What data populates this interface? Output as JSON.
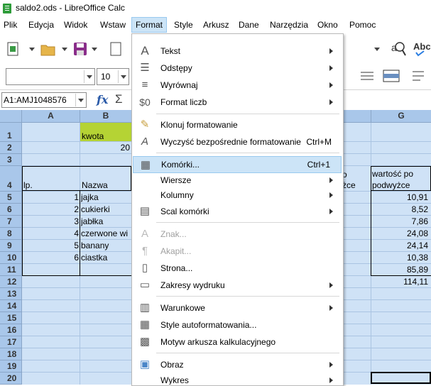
{
  "window": {
    "title": "saldo2.ods - LibreOffice Calc"
  },
  "menubar": [
    {
      "label": "Plik"
    },
    {
      "label": "Edycja"
    },
    {
      "label": "Widok"
    },
    {
      "label": "Wstaw"
    },
    {
      "label": "Format",
      "active": true
    },
    {
      "label": "Style"
    },
    {
      "label": "Arkusz"
    },
    {
      "label": "Dane"
    },
    {
      "label": "Narzędzia"
    },
    {
      "label": "Okno"
    },
    {
      "label": "Pomoc"
    }
  ],
  "toolbar2": {
    "font_size": "10"
  },
  "formulabar": {
    "name_box": "A1:AMJ1048576",
    "fx": "fx",
    "sigma": "Σ"
  },
  "columns": [
    "A",
    "B",
    "G"
  ],
  "rows": [
    "1",
    "2",
    "3",
    "4",
    "5",
    "6",
    "7",
    "8",
    "9",
    "10",
    "11",
    "12",
    "13",
    "14",
    "15",
    "16",
    "17",
    "18",
    "19",
    "20"
  ],
  "cells": {
    "b1": "kwota",
    "b2": "20",
    "a4": "lp.",
    "b4": "Nazwa",
    "g4_line1": "wartość po",
    "g4_line2": "podwyżce",
    "f4_line1": "o",
    "f4_line2": "żce",
    "lp": [
      "1",
      "2",
      "3",
      "4",
      "5",
      "6"
    ],
    "names": [
      "jajka",
      "cukierki",
      "jabłka",
      "czerwone wi",
      "banany",
      "ciastka"
    ],
    "g_values": [
      "10,91",
      "8,52",
      "7,86",
      "24,08",
      "24,14",
      "10,38",
      "85,89",
      "114,11"
    ]
  },
  "format_menu": {
    "items": [
      {
        "label": "Tekst",
        "submenu": true,
        "icon": "text-icon"
      },
      {
        "label": "Odstępy",
        "submenu": true,
        "icon": "spacing-icon"
      },
      {
        "label": "Wyrównaj",
        "submenu": true,
        "icon": "align-icon"
      },
      {
        "label": "Format liczb",
        "submenu": true,
        "icon": "dollar-icon"
      },
      {
        "label": "Klonuj formatowanie",
        "icon": "brush-icon"
      },
      {
        "label": "Wyczyść bezpośrednie formatowanie",
        "shortcut": "Ctrl+M",
        "icon": "clear-format-icon"
      },
      {
        "label": "Komórki...",
        "shortcut": "Ctrl+1",
        "highlighted": true,
        "icon": "cells-icon"
      },
      {
        "label": "Wiersze",
        "submenu": true
      },
      {
        "label": "Kolumny",
        "submenu": true
      },
      {
        "label": "Scal komórki",
        "submenu": true,
        "icon": "merge-icon"
      },
      {
        "label": "Znak...",
        "disabled": true,
        "icon": "char-icon"
      },
      {
        "label": "Akapit...",
        "disabled": true,
        "icon": "paragraph-icon"
      },
      {
        "label": "Strona...",
        "icon": "page-icon"
      },
      {
        "label": "Zakresy wydruku",
        "submenu": true,
        "icon": "print-range-icon"
      },
      {
        "label": "Warunkowe",
        "submenu": true,
        "icon": "conditional-icon"
      },
      {
        "label": "Style autoformatowania...",
        "icon": "autoformat-icon"
      },
      {
        "label": "Motyw arkusza kalkulacyjnego",
        "icon": "theme-icon"
      },
      {
        "label": "Obraz",
        "submenu": true,
        "icon": "image-icon"
      },
      {
        "label": "Wykres",
        "submenu": true
      }
    ]
  },
  "colors": {
    "selection": "#cfe2f6",
    "header": "#a9c7ea",
    "kwota_bg": "#b5d334",
    "menu_highlight": "#cce4f7"
  }
}
